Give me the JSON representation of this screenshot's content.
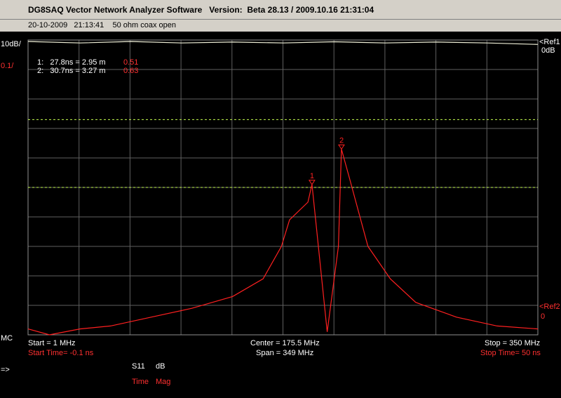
{
  "window": {
    "title": "DG8SAQ Vector Network Analyzer Software   Version:  Beta 28.13 / 2009.10.16 21:31:04",
    "info": "20-10-2009   21:13:41    50 ohm coax open"
  },
  "scales": {
    "trace1_scale": "10dB/",
    "trace2_scale": "0.1/",
    "ref1_label": "<Ref1",
    "ref1_value": "0dB",
    "ref2_label": "<Ref2",
    "ref2_value": "0"
  },
  "markers": [
    {
      "id": "1",
      "text": "1:   27.8ns = 2.95 m",
      "value": "0.51"
    },
    {
      "id": "2",
      "text": "2:   30.7ns = 3.27 m",
      "value": "0.63"
    }
  ],
  "footer": {
    "mc": "MC",
    "arrow": "=>",
    "start": "Start = 1 MHz",
    "center": "Center = 175.5 MHz",
    "stop": "Stop = 350 MHz",
    "start_time": "Start Time= -0.1 ns",
    "span": "Span = 349 MHz",
    "stop_time": "Stop Time= 50 ns",
    "param": "S11",
    "unit": "dB",
    "domain": "Time",
    "format": "Mag"
  },
  "colors": {
    "grid": "#606060",
    "trace_white": "#f0f0d8",
    "trace_red": "#ff2020",
    "limit_lines": "#c8ff50"
  },
  "chart_data": {
    "type": "line",
    "xlabel": "",
    "ylabel": "",
    "xlim": [
      -0.1,
      50
    ],
    "ylim": [
      0,
      1
    ],
    "x_unit": "ns",
    "series": [
      {
        "x": [
          -0.1,
          2,
          5,
          8,
          12,
          16,
          20,
          23,
          24.8,
          25.6,
          27.4,
          27.8,
          29.3,
          30.4,
          30.7,
          31.5,
          33.3,
          35.5,
          38,
          42,
          46,
          50
        ],
        "values": [
          0.02,
          0.0,
          0.02,
          0.03,
          0.06,
          0.09,
          0.13,
          0.19,
          0.3,
          0.39,
          0.45,
          0.51,
          0.01,
          0.3,
          0.63,
          0.53,
          0.3,
          0.19,
          0.11,
          0.06,
          0.03,
          0.02
        ]
      },
      {
        "x": [
          -0.1,
          5,
          10,
          15,
          20,
          25,
          30,
          35,
          40,
          45,
          50
        ],
        "values": [
          0.995,
          0.99,
          0.995,
          0.99,
          0.993,
          0.99,
          0.994,
          0.99,
          0.993,
          0.99,
          0.985
        ]
      }
    ],
    "limit_lines": [
      0.73,
      0.5
    ],
    "markers": [
      {
        "label": "1",
        "x": 27.8,
        "y": 0.51
      },
      {
        "label": "2",
        "x": 30.7,
        "y": 0.63
      }
    ],
    "grid": true
  }
}
